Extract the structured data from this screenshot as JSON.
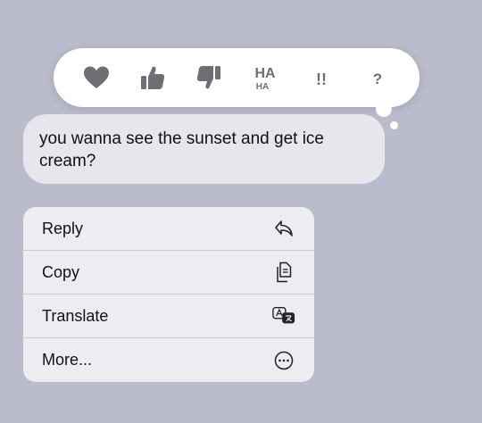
{
  "message": {
    "text": "you wanna see the sunset and get ice cream?"
  },
  "tapbacks": [
    {
      "name": "heart",
      "icon": "heart-icon"
    },
    {
      "name": "thumbs-up",
      "icon": "thumbs-up-icon"
    },
    {
      "name": "thumbs-down",
      "icon": "thumbs-down-icon"
    },
    {
      "name": "haha",
      "icon": "haha-icon",
      "label": "HA",
      "sub": "HA"
    },
    {
      "name": "exclamation",
      "icon": "exclamation-icon",
      "label": "!!"
    },
    {
      "name": "question",
      "icon": "question-icon",
      "label": "?"
    }
  ],
  "menu": {
    "items": [
      {
        "label": "Reply",
        "icon": "reply-icon"
      },
      {
        "label": "Copy",
        "icon": "copy-icon"
      },
      {
        "label": "Translate",
        "icon": "translate-icon"
      },
      {
        "label": "More...",
        "icon": "more-icon"
      }
    ]
  },
  "colors": {
    "background": "#babbcb",
    "bubble": "#e6e6ec",
    "tapback_icon": "#6e6e73"
  }
}
